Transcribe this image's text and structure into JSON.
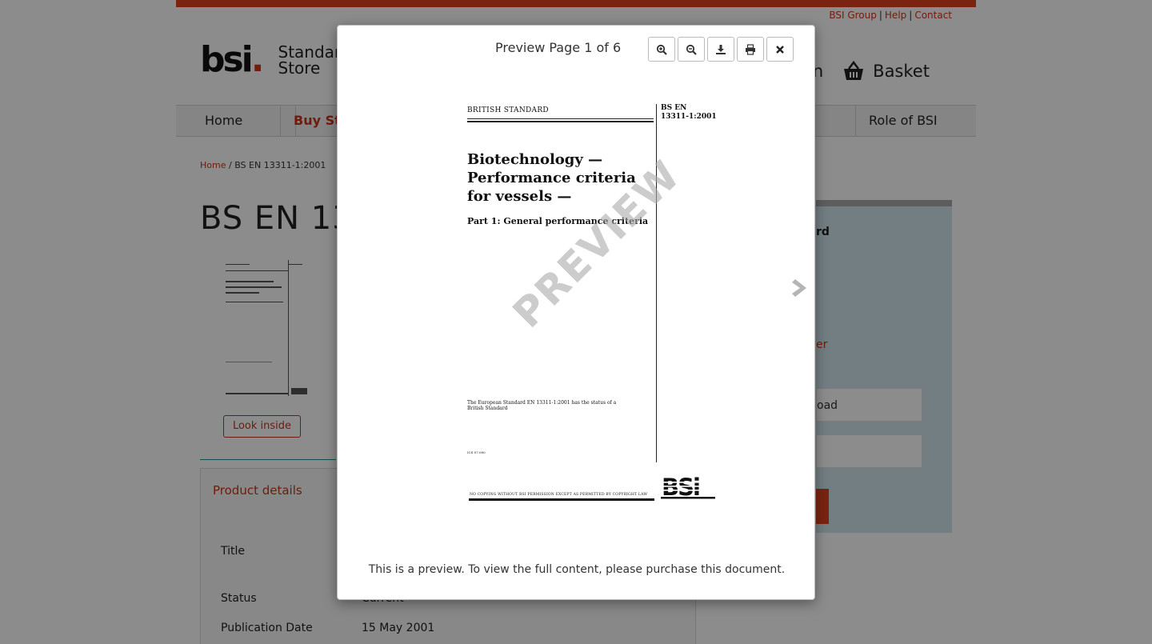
{
  "utility_links": [
    "BSI Group",
    "Help",
    "Contact"
  ],
  "logo": {
    "mark": "bsi",
    "dot": ".",
    "line1": "Standards",
    "line2": "Store"
  },
  "header": {
    "signin_fragment": "in",
    "basket": "Basket"
  },
  "nav": {
    "home": "Home",
    "buy": "Buy Sta",
    "role": "Role of BSI"
  },
  "breadcrumb": {
    "home": "Home",
    "separator": "/",
    "current": "BS EN 13311-1:2001"
  },
  "page_title": "BS EN 1331",
  "look_inside": "Look inside",
  "details": {
    "heading": "Product details",
    "rows": [
      {
        "label": "Title",
        "value": ""
      },
      {
        "label": "Status",
        "value": "Current"
      },
      {
        "label": "Publication Date",
        "value": "15 May 2001"
      }
    ]
  },
  "sidepanel": {
    "fragment1": "rd",
    "fragment2": "er",
    "field1": "oad",
    "field2": ""
  },
  "modal": {
    "title": "Preview Page 1 of 6",
    "tools": [
      "zoom-in",
      "zoom-out",
      "download",
      "print",
      "close"
    ],
    "footer": "This is a preview. To view the full content, please purchase this document.",
    "watermark": "PREVIEW"
  },
  "doc": {
    "label": "BRITISH STANDARD",
    "code_line1": "BS EN",
    "code_line2": "13311-1:2001",
    "heading_line1": "Biotechnology —",
    "heading_line2": "Performance criteria",
    "heading_line3": "for vessels —",
    "subheading": "Part 1: General performance criteria",
    "small_line1": "The European Standard EN 13311-1:2001 has the status of a",
    "small_line2": "British Standard",
    "ics": "ICS 07.080",
    "footer": "NO COPYING WITHOUT BSI PERMISSION EXCEPT AS PERMITTED BY COPYRIGHT LAW"
  }
}
